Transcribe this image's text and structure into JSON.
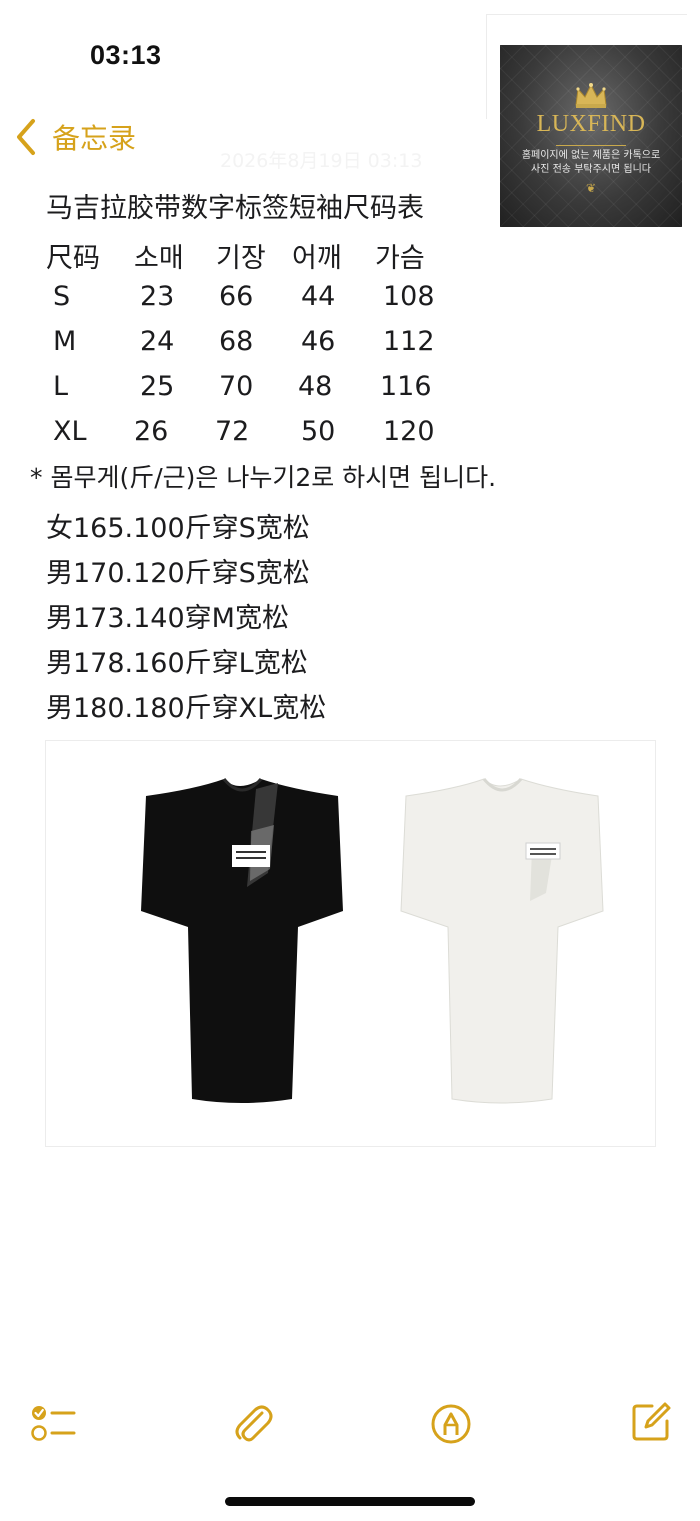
{
  "status_bar": {
    "time": "03:13"
  },
  "nav": {
    "back_label": "备忘录"
  },
  "header": {
    "faded_date": "2026年8月19日 03:13"
  },
  "logo": {
    "wordmark": "LUXFIND",
    "tagline_line1": "홈페이지에 없는 제품은 카톡으로",
    "tagline_line2": "사진 전송 부탁주시면 됩니다",
    "accent_color": "#d8b657"
  },
  "note": {
    "title": "马吉拉胶带数字标签短袖尺码表",
    "size_table": {
      "headers": [
        "尺码",
        "소매",
        "기장",
        "어깨",
        "가슴"
      ],
      "rows": [
        [
          "S",
          "23",
          "66",
          "44",
          "108"
        ],
        [
          "M",
          "24",
          "68",
          "46",
          "112"
        ],
        [
          "L",
          "25",
          "70",
          "48",
          "116"
        ],
        [
          "XL",
          "26",
          "72",
          "50",
          "120"
        ]
      ]
    },
    "footnote": "* 몸무게(斤/근)은 나누기2로 하시면 됩니다.",
    "recommendations": [
      "女165.100斤穿S宽松",
      "男170.120斤穿S宽松",
      "男173.140穿M宽松",
      "男178.160斤穿L宽松",
      "男180.180斤穿XL宽松"
    ]
  },
  "toolbar": {
    "items": [
      "checklist-icon",
      "paperclip-icon",
      "markup-pen-icon",
      "compose-icon"
    ],
    "accent_color": "#d6a21b"
  }
}
